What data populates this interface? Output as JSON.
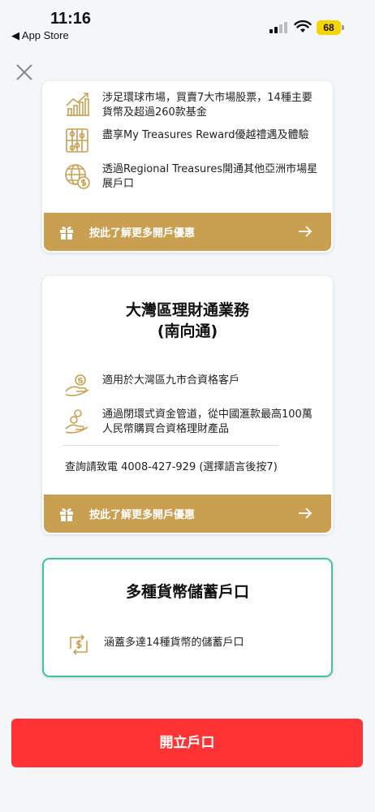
{
  "status_bar": {
    "time": "11:16",
    "back_app": "◀ App Store",
    "battery": "68"
  },
  "card1": {
    "features": [
      {
        "icon": "growth-chart-icon",
        "text": "涉足環球市場，買賣7大市場股票，14種主要貨幣及超過260款基金"
      },
      {
        "icon": "abacus-icon",
        "text": "盡享My Treasures Reward優越禮遇及體驗"
      },
      {
        "icon": "globe-dollar-icon",
        "text": "透過Regional Treasures開通其他亞洲市場星展戶口"
      }
    ],
    "cta": "按此了解更多開戶優惠"
  },
  "card2": {
    "title_line1": "大灣區理財通業務",
    "title_line2": "(南向通)",
    "features": [
      {
        "icon": "hand-coin-icon",
        "text": "適用於大灣區九市合資格客戶"
      },
      {
        "icon": "hand-money-icon",
        "text": "通過閉環式資金管道，從中國滙款最高100萬人民幣購買合資格理財產品"
      }
    ],
    "enquiry": "查詢請致電 4008-427-929 (選擇語言後按7)",
    "cta": "按此了解更多開戶優惠"
  },
  "card3": {
    "title": "多種貨幣儲蓄戶口",
    "features": [
      {
        "icon": "currency-exchange-icon",
        "text": "涵蓋多達14種貨幣的儲蓄戶口"
      }
    ]
  },
  "open_account_button": "開立戶口",
  "colors": {
    "gold": "#c9a052",
    "red": "#ff3333",
    "green_border": "#3fc49a"
  }
}
